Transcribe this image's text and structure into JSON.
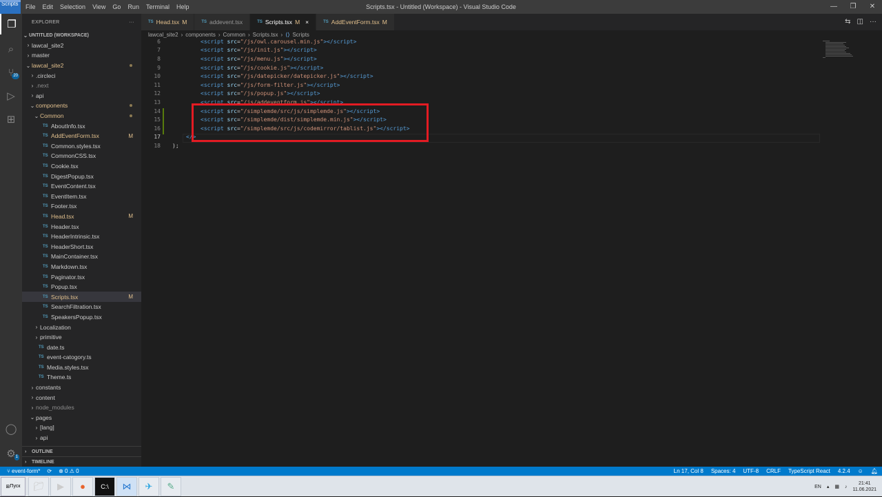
{
  "window": {
    "title": "Scripts.tsx - Untitled (Workspace) - Visual Studio Code",
    "logo_text": "Scripts"
  },
  "menu": [
    "File",
    "Edit",
    "Selection",
    "View",
    "Go",
    "Run",
    "Terminal",
    "Help"
  ],
  "activity": {
    "explorer_icon": "files-icon",
    "search_icon": "search-icon",
    "scm_icon": "source-control-icon",
    "scm_badge": "20",
    "debug_icon": "run-debug-icon",
    "extensions_icon": "extensions-icon",
    "account_icon": "account-icon",
    "settings_icon": "gear-icon",
    "settings_badge": "1"
  },
  "explorer": {
    "title": "EXPLORER",
    "more": "···",
    "workspace": "UNTITLED (WORKSPACE)",
    "rows": [
      {
        "label": "lawcal_site2",
        "indent": 1,
        "chev": "›",
        "kind": "folder"
      },
      {
        "label": "master",
        "indent": 1,
        "chev": "›",
        "kind": "folder"
      },
      {
        "label": "lawcal_site2",
        "indent": 1,
        "chev": "⌄",
        "kind": "folder",
        "mod": true,
        "dot": true
      },
      {
        "label": ".circleci",
        "indent": 2,
        "chev": "›",
        "kind": "folder"
      },
      {
        "label": ".next",
        "indent": 2,
        "chev": "›",
        "kind": "folder",
        "dim": true
      },
      {
        "label": "api",
        "indent": 2,
        "chev": "›",
        "kind": "folder"
      },
      {
        "label": "components",
        "indent": 2,
        "chev": "⌄",
        "kind": "folder",
        "mod": true,
        "dot": true
      },
      {
        "label": "Common",
        "indent": 3,
        "chev": "⌄",
        "kind": "folder",
        "mod": true,
        "dot": true
      },
      {
        "label": "AboutInfo.tsx",
        "indent": 4,
        "kind": "ts"
      },
      {
        "label": "AddEventForm.tsx",
        "indent": 4,
        "kind": "ts",
        "mod": true,
        "m": "M"
      },
      {
        "label": "Common.styles.tsx",
        "indent": 4,
        "kind": "ts"
      },
      {
        "label": "CommonCSS.tsx",
        "indent": 4,
        "kind": "ts"
      },
      {
        "label": "Cookie.tsx",
        "indent": 4,
        "kind": "ts"
      },
      {
        "label": "DigestPopup.tsx",
        "indent": 4,
        "kind": "ts"
      },
      {
        "label": "EventContent.tsx",
        "indent": 4,
        "kind": "ts"
      },
      {
        "label": "EventItem.tsx",
        "indent": 4,
        "kind": "ts"
      },
      {
        "label": "Footer.tsx",
        "indent": 4,
        "kind": "ts"
      },
      {
        "label": "Head.tsx",
        "indent": 4,
        "kind": "ts",
        "mod": true,
        "m": "M"
      },
      {
        "label": "Header.tsx",
        "indent": 4,
        "kind": "ts"
      },
      {
        "label": "HeaderIntrinsic.tsx",
        "indent": 4,
        "kind": "ts"
      },
      {
        "label": "HeaderShort.tsx",
        "indent": 4,
        "kind": "ts"
      },
      {
        "label": "MainContainer.tsx",
        "indent": 4,
        "kind": "ts"
      },
      {
        "label": "Markdown.tsx",
        "indent": 4,
        "kind": "ts"
      },
      {
        "label": "Paginator.tsx",
        "indent": 4,
        "kind": "ts"
      },
      {
        "label": "Popup.tsx",
        "indent": 4,
        "kind": "ts"
      },
      {
        "label": "Scripts.tsx",
        "indent": 4,
        "kind": "ts",
        "mod": true,
        "m": "M",
        "selected": true
      },
      {
        "label": "SearchFiltration.tsx",
        "indent": 4,
        "kind": "ts"
      },
      {
        "label": "SpeakersPopup.tsx",
        "indent": 4,
        "kind": "ts"
      },
      {
        "label": "Localization",
        "indent": 3,
        "chev": "›",
        "kind": "folder"
      },
      {
        "label": "primitive",
        "indent": 3,
        "chev": "›",
        "kind": "folder"
      },
      {
        "label": "date.ts",
        "indent": 3,
        "kind": "ts"
      },
      {
        "label": "event-catogory.ts",
        "indent": 3,
        "kind": "ts"
      },
      {
        "label": "Media.styles.tsx",
        "indent": 3,
        "kind": "ts"
      },
      {
        "label": "Theme.ts",
        "indent": 3,
        "kind": "ts"
      },
      {
        "label": "constants",
        "indent": 2,
        "chev": "›",
        "kind": "folder"
      },
      {
        "label": "content",
        "indent": 2,
        "chev": "›",
        "kind": "folder"
      },
      {
        "label": "node_modules",
        "indent": 2,
        "chev": "›",
        "kind": "folder",
        "dim": true
      },
      {
        "label": "pages",
        "indent": 2,
        "chev": "⌄",
        "kind": "folder"
      },
      {
        "label": "[lang]",
        "indent": 3,
        "chev": "›",
        "kind": "folder"
      },
      {
        "label": "api",
        "indent": 3,
        "chev": "›",
        "kind": "folder"
      }
    ],
    "outline": "OUTLINE",
    "timeline": "TIMELINE"
  },
  "tabs": [
    {
      "label": "Head.tsx",
      "suffix": "M",
      "mod": true,
      "ts": "TS"
    },
    {
      "label": "addevent.tsx",
      "suffix": "",
      "ts": "TS"
    },
    {
      "label": "Scripts.tsx",
      "suffix": "M",
      "active": true,
      "ts": "TS",
      "close": "×"
    },
    {
      "label": "AddEventForm.tsx",
      "suffix": "M",
      "mod": true,
      "ts": "TS"
    }
  ],
  "breadcrumb": [
    "lawcal_site2",
    "components",
    "Common",
    "Scripts.tsx",
    "Scripts"
  ],
  "code_lines": [
    {
      "n": "6",
      "src": "/js/owl.carousel.min.js"
    },
    {
      "n": "7",
      "src": "/js/init.js"
    },
    {
      "n": "8",
      "src": "/js/menu.js"
    },
    {
      "n": "9",
      "src": "/js/cookie.js"
    },
    {
      "n": "10",
      "src": "/js/datepicker/datepicker.js"
    },
    {
      "n": "11",
      "src": "/js/form-filter.js"
    },
    {
      "n": "12",
      "src": "/js/popup.js"
    },
    {
      "n": "13",
      "src": "/js/addeventform.js"
    },
    {
      "n": "14",
      "src": "/simplemde/src/js/simplemde.js"
    },
    {
      "n": "15",
      "src": "/simplemde/dist/simplemde.min.js"
    },
    {
      "n": "16",
      "src": "/simplemde/src/js/codemirror/tablist.js"
    }
  ],
  "line17": {
    "n": "17",
    "text": "</>"
  },
  "line18": {
    "n": "18",
    "text": ");"
  },
  "status": {
    "branch": "event-form*",
    "sync": "⟳",
    "problems": "⊗ 0 ⚠ 0",
    "position": "Ln 17, Col 8",
    "spaces": "Spaces: 4",
    "encoding": "UTF-8",
    "eol": "CRLF",
    "language": "TypeScript React",
    "version": "4.2.4"
  },
  "taskbar": {
    "start": "Пуск",
    "lang": "EN",
    "time": "21:41",
    "date": "11.06.2021"
  }
}
